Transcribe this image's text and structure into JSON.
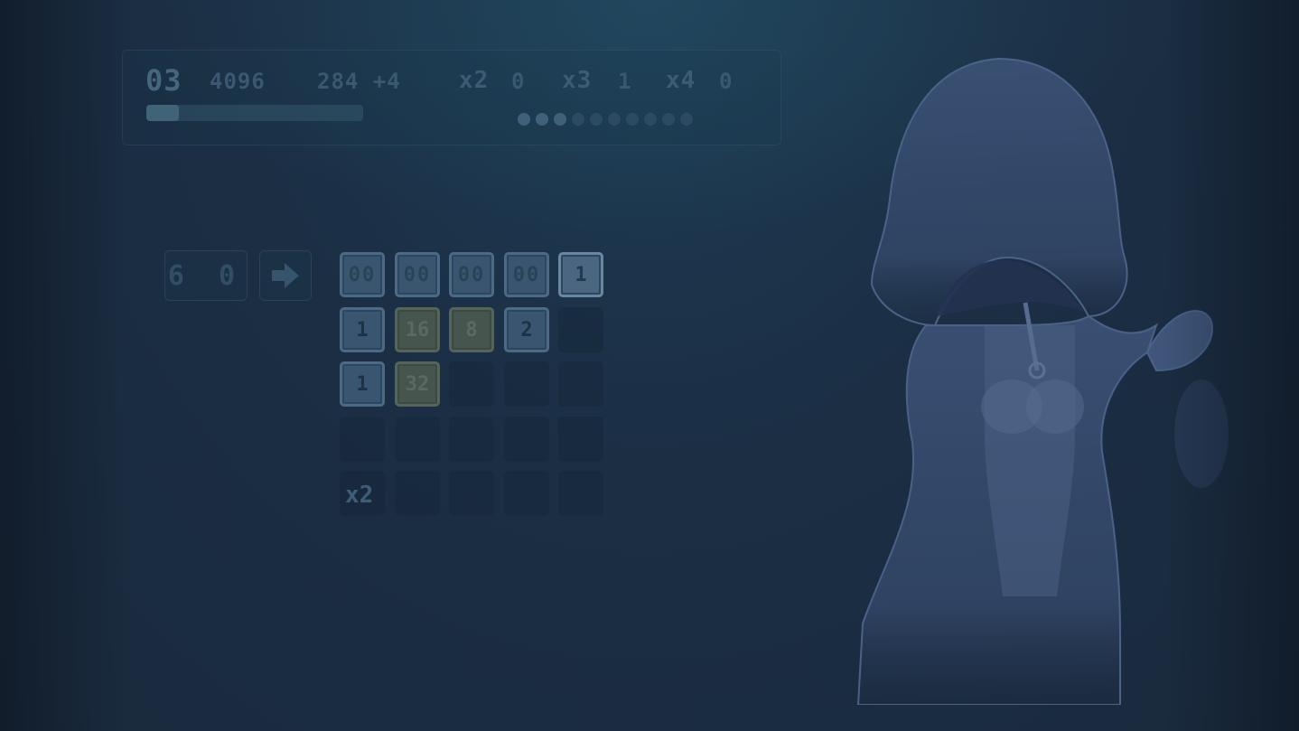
{
  "hud": {
    "level": "03",
    "score": "4096",
    "moves": "284 +4",
    "multipliers": [
      {
        "label": "x2",
        "value": "0"
      },
      {
        "label": "x3",
        "value": "1"
      },
      {
        "label": "x4",
        "value": "0"
      }
    ],
    "progress": 0.15,
    "dots_total": 10,
    "dots_lit": 3
  },
  "controls": {
    "queue_count": "6 0"
  },
  "board": {
    "rows": [
      [
        "00",
        "00",
        "00",
        "00",
        "1"
      ],
      [
        "1",
        "16",
        "8",
        "2",
        ""
      ],
      [
        "1",
        "32",
        "",
        "",
        ""
      ],
      [
        "",
        "",
        "",
        "",
        ""
      ],
      [
        "",
        "",
        "",
        "",
        ""
      ]
    ],
    "combo": "x2"
  },
  "colors": {
    "background": "#1b2e44",
    "tile": "#3a5570",
    "tile_olive": "#46554d",
    "character": "#3d5478"
  }
}
